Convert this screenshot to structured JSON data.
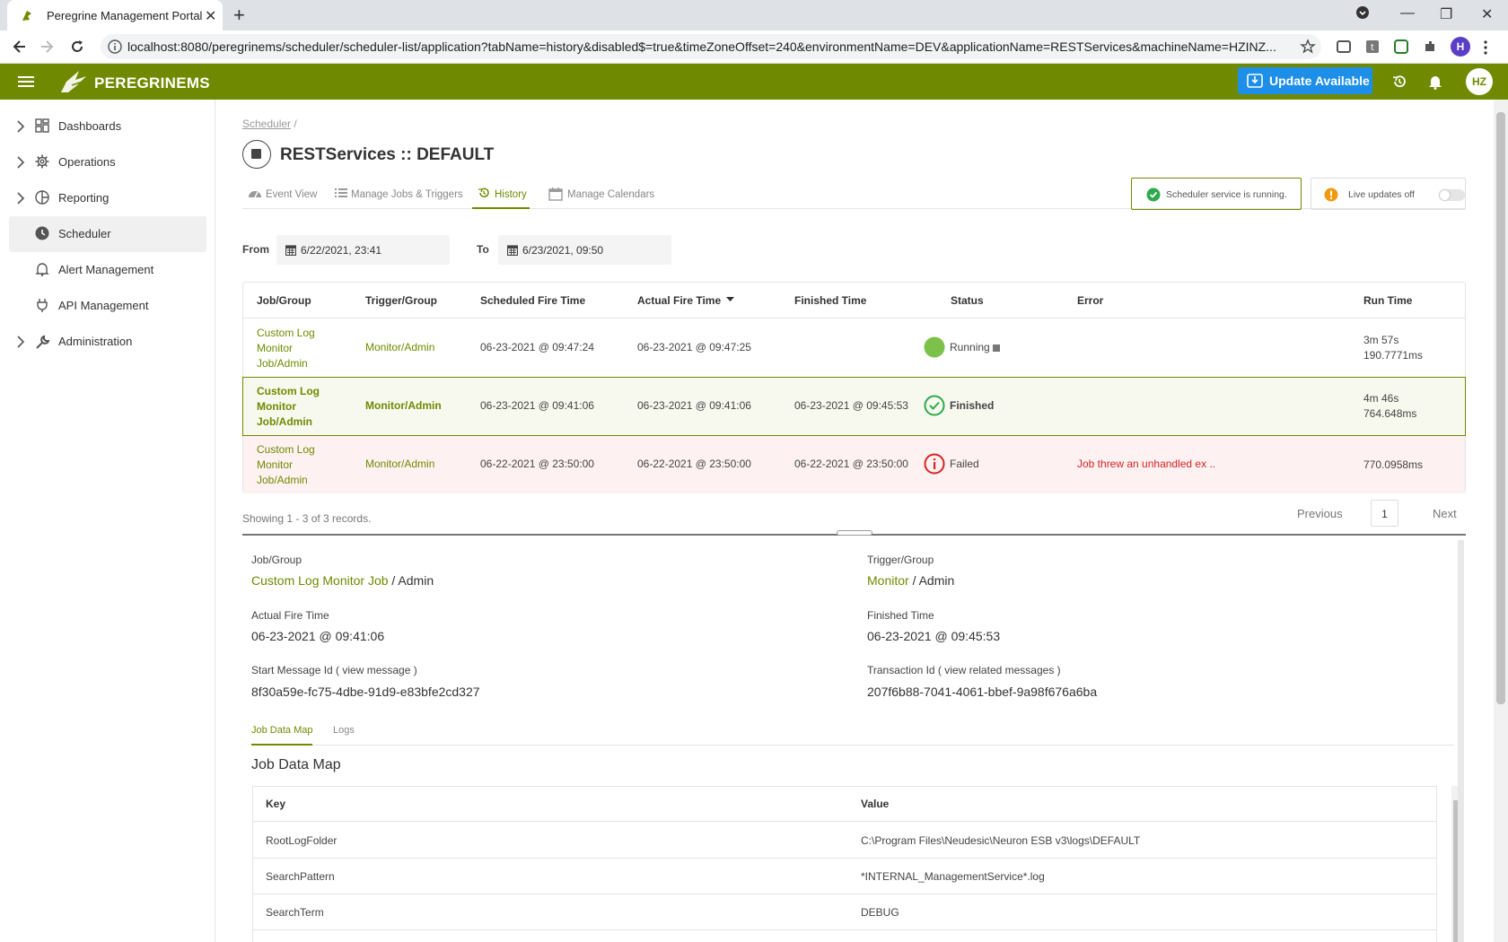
{
  "browser": {
    "tab_title": "Peregrine Management Portal",
    "url": "localhost:8080/peregrinems/scheduler/scheduler-list/application?tabName=history&disabled$=true&timeZoneOffset=240&environmentName=DEV&applicationName=RESTServices&machineName=HZINZ...",
    "profile_initial": "H"
  },
  "app": {
    "brand": "PEREGRINEMS",
    "update_label": "Update Available",
    "avatar": "HZ",
    "accent": "#6f8a00",
    "update_color": "#1e8fe9"
  },
  "sidebar": {
    "items": [
      {
        "label": "Dashboards",
        "icon": "dashboard-icon"
      },
      {
        "label": "Operations",
        "icon": "gear-icon"
      },
      {
        "label": "Reporting",
        "icon": "pie-chart-icon"
      },
      {
        "label": "Scheduler",
        "icon": "clock-icon",
        "active": true
      },
      {
        "label": "Alert Management",
        "icon": "bell-icon"
      },
      {
        "label": "API Management",
        "icon": "plug-icon"
      },
      {
        "label": "Administration",
        "icon": "wrench-icon"
      }
    ]
  },
  "page": {
    "breadcrumb": "Scheduler",
    "breadcrumb_sep": "/",
    "title": "RESTServices :: DEFAULT",
    "tabs": [
      {
        "label": "Event View",
        "icon": "gauge-icon"
      },
      {
        "label": "Manage Jobs & Triggers",
        "icon": "list-icon"
      },
      {
        "label": "History",
        "icon": "history-icon",
        "active": true
      },
      {
        "label": "Manage Calendars",
        "icon": "calendar-icon"
      }
    ],
    "service_status": "Scheduler service is running.",
    "live_updates": "Live updates off"
  },
  "filter": {
    "from_label": "From",
    "from_value": "6/22/2021, 23:41",
    "to_label": "To",
    "to_value": "6/23/2021, 09:50"
  },
  "table": {
    "headers": [
      "Job/Group",
      "Trigger/Group",
      "Scheduled Fire Time",
      "Actual Fire Time",
      "Finished Time",
      "Status",
      "Error",
      "Run Time"
    ],
    "rows": [
      {
        "job": [
          "Custom Log",
          "Monitor",
          "Job/Admin"
        ],
        "trigger": "Monitor/Admin",
        "scheduled": "06-23-2021 @ 09:47:24",
        "actual": "06-23-2021 @ 09:47:25",
        "finished": "",
        "status": "Running",
        "error": "",
        "runtime": [
          "3m 57s",
          "190.7771ms"
        ]
      },
      {
        "job": [
          "Custom Log",
          "Monitor",
          "Job/Admin"
        ],
        "trigger": "Monitor/Admin",
        "scheduled": "06-23-2021 @ 09:41:06",
        "actual": "06-23-2021 @ 09:41:06",
        "finished": "06-23-2021 @ 09:45:53",
        "status": "Finished",
        "error": "",
        "runtime": [
          "4m 46s",
          "764.648ms"
        ]
      },
      {
        "job": [
          "Custom Log",
          "Monitor",
          "Job/Admin"
        ],
        "trigger": "Monitor/Admin",
        "scheduled": "06-22-2021 @ 23:50:00",
        "actual": "06-22-2021 @ 23:50:00",
        "finished": "06-22-2021 @ 23:50:00",
        "status": "Failed",
        "error": "Job threw an unhandled ex ..",
        "runtime": [
          "770.0958ms",
          ""
        ]
      }
    ],
    "records": "Showing 1 - 3 of 3 records.",
    "prev": "Previous",
    "page": "1",
    "next": "Next"
  },
  "details": {
    "job_group_label": "Job/Group",
    "job_name": "Custom Log Monitor Job",
    "job_group_suffix": "/ Admin",
    "trigger_group_label": "Trigger/Group",
    "trigger_name": "Monitor",
    "trigger_group_suffix": "/ Admin",
    "actual_fire_label": "Actual Fire Time",
    "actual_fire_value": "06-23-2021 @ 09:41:06",
    "finished_label": "Finished Time",
    "finished_value": "06-23-2021 @ 09:45:53",
    "start_msg_label": "Start Message Id ( view message )",
    "start_msg_value": "8f30a59e-fc75-4dbe-91d9-e83bfe2cd327",
    "txn_label": "Transaction Id ( view related messages )",
    "txn_value": "207f6b88-7041-4061-bbef-9a98f676a6ba",
    "tabs": [
      "Job Data Map",
      "Logs"
    ],
    "jdm_title": "Job Data Map",
    "jdm_headers": [
      "Key",
      "Value"
    ],
    "jdm_rows": [
      {
        "key": "RootLogFolder",
        "value": "C:\\Program Files\\Neudesic\\Neuron ESB v3\\logs\\DEFAULT"
      },
      {
        "key": "SearchPattern",
        "value": "*INTERNAL_ManagementService*.log"
      },
      {
        "key": "SearchTerm",
        "value": "DEBUG"
      }
    ]
  }
}
